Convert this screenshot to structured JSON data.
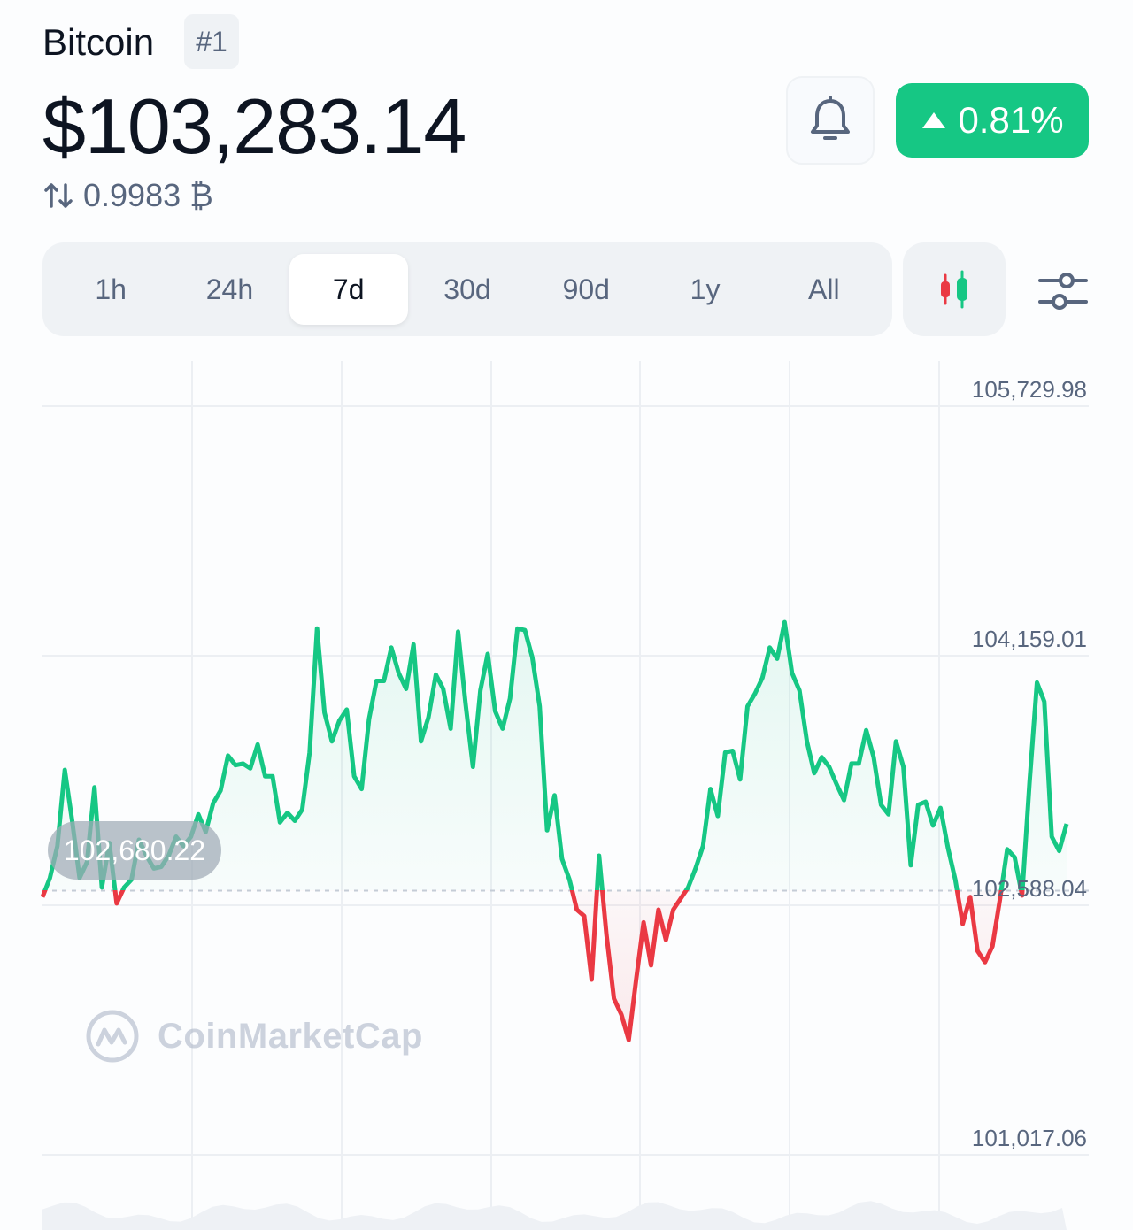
{
  "header": {
    "coin_name": "Bitcoin",
    "rank": "#1",
    "price": "$103,283.14",
    "btc_value": "0.9983 ₿",
    "change": "0.81%",
    "change_direction": "up",
    "bell_icon": "bell-icon"
  },
  "tabs": [
    {
      "label": "1h",
      "active": false
    },
    {
      "label": "24h",
      "active": false
    },
    {
      "label": "7d",
      "active": true
    },
    {
      "label": "30d",
      "active": false
    },
    {
      "label": "90d",
      "active": false
    },
    {
      "label": "1y",
      "active": false
    },
    {
      "label": "All",
      "active": false
    }
  ],
  "controls": {
    "candle_icon": "candlestick-icon",
    "settings_icon": "sliders-icon"
  },
  "colors": {
    "up": "#16c784",
    "down": "#ea3943",
    "text_primary": "#0d1421",
    "text_secondary": "#58667e"
  },
  "watermark": "CoinMarketCap",
  "chart_data": {
    "type": "line",
    "title": "",
    "xlabel": "",
    "ylabel": "",
    "baseline": 102680.22,
    "baseline_label": "102,680.22",
    "y_ticks": [
      105729.98,
      104159.01,
      102588.04,
      101017.06
    ],
    "y_tick_labels": [
      "105,729.98",
      "104,159.01",
      "102,588.04",
      "101,017.06"
    ],
    "ylim": [
      101017.06,
      105729.98
    ],
    "grid": true,
    "series": [
      {
        "values": [
          102640,
          102760,
          102960,
          103440,
          103120,
          102760,
          102860,
          103330,
          102700,
          102980,
          102600,
          102700,
          102750,
          103000,
          102900,
          102820,
          102830,
          102900,
          103020,
          102960,
          103020,
          103160,
          103050,
          103230,
          103310,
          103530,
          103470,
          103480,
          103450,
          103600,
          103400,
          103400,
          103110,
          103170,
          103120,
          103190,
          103550,
          104330,
          103800,
          103620,
          103750,
          103820,
          103400,
          103320,
          103760,
          104000,
          104000,
          104210,
          104050,
          103950,
          104230,
          103620,
          103770,
          104040,
          103950,
          103700,
          104310,
          103860,
          103460,
          103940,
          104170,
          103810,
          103700,
          103890,
          104330,
          104320,
          104150,
          103840,
          103060,
          103280,
          102880,
          102750,
          102560,
          102520,
          102120,
          102900,
          102400,
          102000,
          101900,
          101740,
          102120,
          102480,
          102210,
          102560,
          102370,
          102560,
          102630,
          102700,
          102820,
          102960,
          103320,
          103150,
          103550,
          103560,
          103380,
          103840,
          103920,
          104020,
          104210,
          104140,
          104370,
          104050,
          103940,
          103620,
          103420,
          103520,
          103460,
          103350,
          103250,
          103480,
          103480,
          103690,
          103520,
          103220,
          103160,
          103620,
          103460,
          102840,
          103220,
          103240,
          103090,
          103200,
          102950,
          102750,
          102470,
          102640,
          102300,
          102230,
          102330,
          102620,
          102940,
          102890,
          102650,
          103360,
          103990,
          103870,
          103020,
          102930,
          103100
        ]
      }
    ]
  }
}
